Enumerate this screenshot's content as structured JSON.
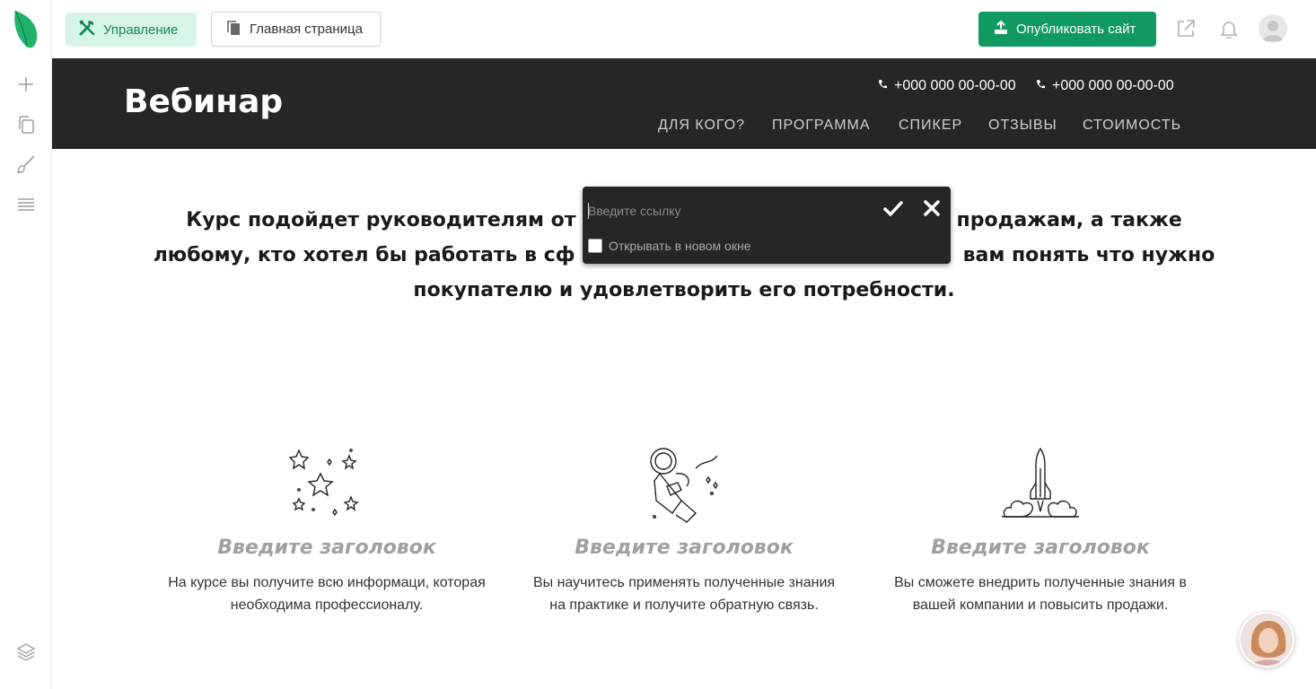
{
  "toolbar": {
    "manage_label": "Управление",
    "home_label": "Главная страница",
    "publish_label": "Опубликовать сайт"
  },
  "sidebar": {
    "items": [
      {
        "icon": "plus-icon"
      },
      {
        "icon": "pages-icon"
      },
      {
        "icon": "brush-icon"
      },
      {
        "icon": "list-icon"
      },
      {
        "icon": "layers-icon"
      }
    ]
  },
  "site": {
    "title": "Вебинар",
    "phones": [
      "+000 000 00-00-00",
      "+000 000 00-00-00"
    ],
    "nav": [
      "ДЛЯ КОГО?",
      "ПРОГРАММА",
      "СПИКЕР",
      "ОТЗЫВЫ",
      "СТОИМОСТЬ"
    ]
  },
  "lead": {
    "line1_a": "Курс подойдет руководителям от",
    "line1_b": "продажам, а также",
    "line2_a": "любому, кто хотел бы работать в сф",
    "line2_b": "вам понять что нужно",
    "line3": "покупателю и удовлетворить его потребности."
  },
  "features": [
    {
      "icon": "stars-icon",
      "title": "Введите заголовок",
      "text_1": "На курсе вы получите всю информаци, которая",
      "text_2": "необходима профессионалу."
    },
    {
      "icon": "astronaut-icon",
      "title": "Введите заголовок",
      "text_1": "Вы научитесь применять полученные знания",
      "text_2": "на практике и получите обратную связь."
    },
    {
      "icon": "rocket-icon",
      "title": "Введите заголовок",
      "text_1": "Вы сможете внедрить полученные знания в",
      "text_2": "вашей компании и повысить продажи."
    }
  ],
  "link_popover": {
    "placeholder": "Введите ссылку",
    "new_window_label": "Открывать в новом окне",
    "new_window_checked": false
  },
  "colors": {
    "accent": "#109a62",
    "accent_light": "#d7f5e6",
    "header_bg": "#262626",
    "muted_title": "#a0a0a0"
  }
}
